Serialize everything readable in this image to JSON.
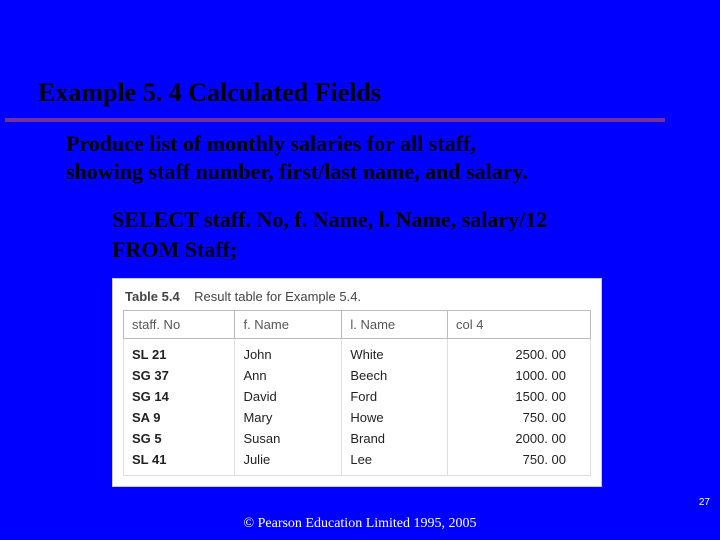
{
  "title": "Example 5. 4  Calculated Fields",
  "description_line1": "Produce list of monthly salaries for all staff,",
  "description_line2": "showing staff number, first/last name, and  salary.",
  "sql_line1": "SELECT staff. No, f. Name, l. Name, salary/12",
  "sql_line2": "FROM Staff;",
  "table": {
    "caption_bold": "Table 5.4",
    "caption_rest": "Result table for Example 5.4.",
    "headers": [
      "staff. No",
      "f. Name",
      "l. Name",
      "col 4"
    ],
    "rows": [
      [
        "SL 21",
        "John",
        "White",
        "2500. 00"
      ],
      [
        "SG 37",
        "Ann",
        "Beech",
        "1000. 00"
      ],
      [
        "SG 14",
        "David",
        "Ford",
        "1500. 00"
      ],
      [
        "SA 9",
        "Mary",
        "Howe",
        "750. 00"
      ],
      [
        "SG 5",
        "Susan",
        "Brand",
        "2000. 00"
      ],
      [
        "SL 41",
        "Julie",
        "Lee",
        "750. 00"
      ]
    ]
  },
  "page_number": "27",
  "copyright": "© Pearson Education Limited 1995, 2005"
}
